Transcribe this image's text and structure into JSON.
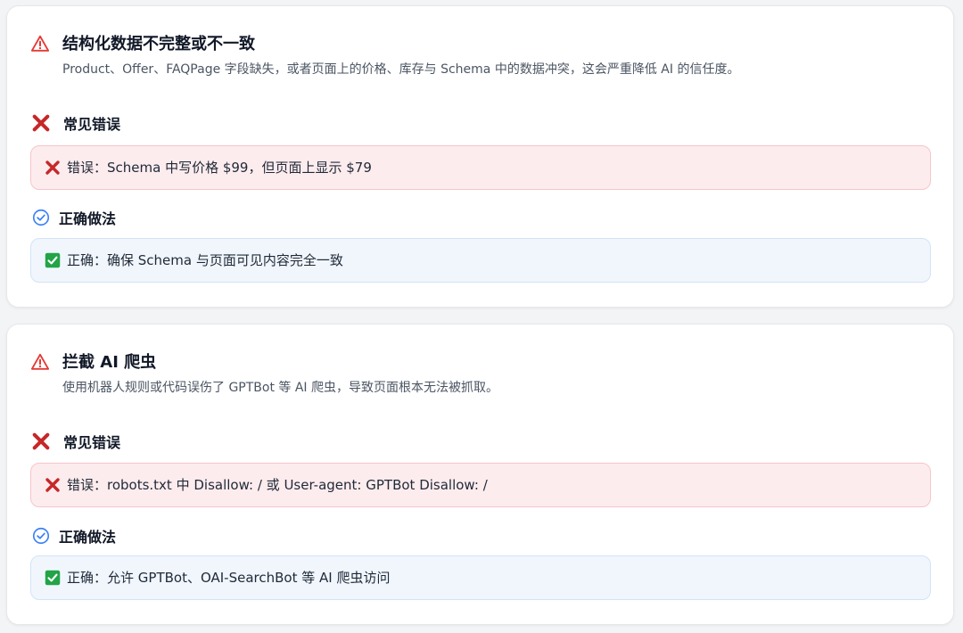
{
  "issues": [
    {
      "title": "结构化数据不完整或不一致",
      "description": "Product、Offer、FAQPage 字段缺失，或者页面上的价格、库存与 Schema 中的数据冲突，这会严重降低 AI 的信任度。",
      "mistake_heading": "常见错误",
      "mistake_text": "错误：Schema 中写价格 $99，但页面上显示 $79",
      "fix_heading": "正确做法",
      "fix_text": "正确：确保 Schema 与页面可见内容完全一致"
    },
    {
      "title": "拦截 AI 爬虫",
      "description": "使用机器人规则或代码误伤了 GPTBot 等 AI 爬虫，导致页面根本无法被抓取。",
      "mistake_heading": "常见错误",
      "mistake_text": "错误：robots.txt 中 Disallow: / 或 User-agent: GPTBot Disallow: /",
      "fix_heading": "正确做法",
      "fix_text": "正确：允许 GPTBot、OAI-SearchBot 等 AI 爬虫访问"
    }
  ],
  "icons": {
    "issue": "warning-triangle-icon",
    "mistake": "cross-mark-icon",
    "fix_heading": "check-circle-icon",
    "fix_box": "check-box-icon"
  },
  "colors": {
    "warning_red": "#e53935",
    "cross_red": "#c62828",
    "check_blue": "#3b82f6",
    "check_green": "#22a447",
    "mistake_bg": "#fdecee",
    "fix_bg": "#f1f6fd"
  }
}
